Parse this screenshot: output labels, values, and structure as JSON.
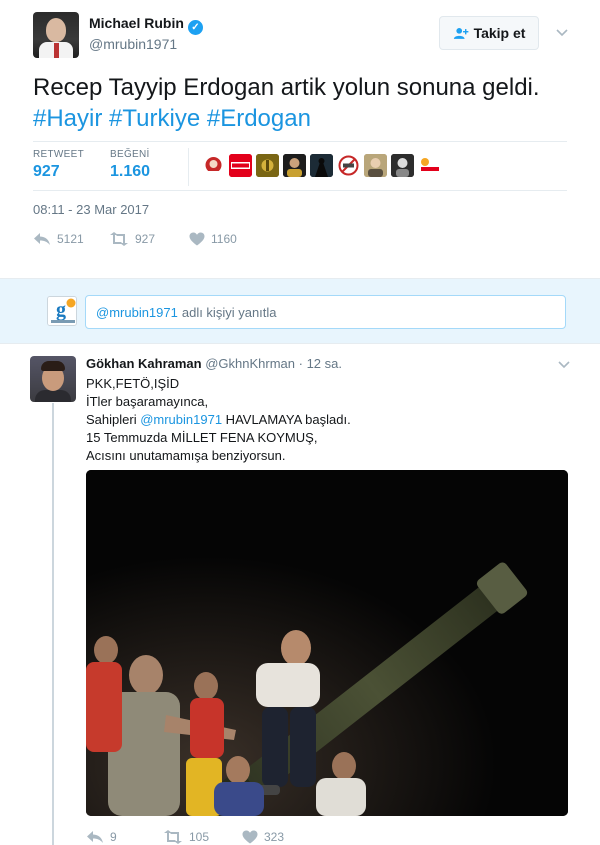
{
  "main_tweet": {
    "author_name": "Michael Rubin",
    "author_handle": "@mrubin1971",
    "follow_label": "Takip et",
    "text": "Recep Tayyip Erdogan artik yolun sonuna geldi.",
    "hashtags": [
      "#Hayir",
      "#Turkiye",
      "#Erdogan"
    ],
    "stats": {
      "retweet_label": "RETWEET",
      "retweet_value": "927",
      "like_label": "BEĞENİ",
      "like_value": "1.160"
    },
    "timestamp": "08:11 - 23 Mar 2017",
    "actions": {
      "reply_count": "5121",
      "retweet_count": "927",
      "like_count": "1160"
    }
  },
  "reply_bar": {
    "mention": "@mrubin1971",
    "placeholder_rest": "adlı kişiyi yanıtla"
  },
  "reply_tweet": {
    "author_name": "Gökhan Kahraman",
    "author_handle": "@GkhnKhrman",
    "time": "· 12 sa.",
    "lines": {
      "l1": "PKK,FETÖ,IŞİD",
      "l2": "İTler başaramayınca,",
      "l3_pre": "Sahipleri ",
      "l3_mention": "@mrubin1971",
      "l3_post": " HAVLAMAYA başladı.",
      "l4": "15 Temmuzda MİLLET FENA KOYMUŞ,",
      "l5": "Acısını unutamamışa benziyorsun."
    },
    "actions": {
      "reply_count": "9",
      "retweet_count": "105",
      "like_count": "323"
    }
  },
  "colors": {
    "link": "#1b95e0",
    "verified": "#1da1f2",
    "muted": "#657786",
    "reply_bg": "#e8f5fd"
  },
  "icons": [
    "verified-icon",
    "follow-person-icon",
    "chevron-down-icon",
    "reply-icon",
    "retweet-icon",
    "heart-icon"
  ]
}
